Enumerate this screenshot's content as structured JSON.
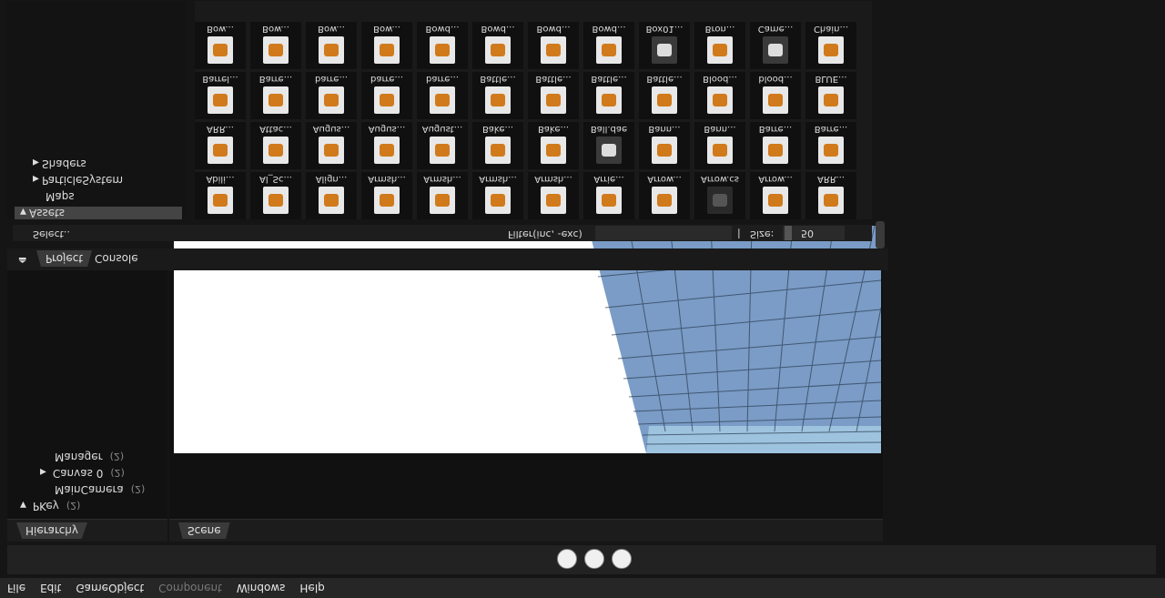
{
  "menubar": [
    "File",
    "Edit",
    "GameObject",
    "Component",
    "Windows",
    "Help"
  ],
  "hierarchy": {
    "tab": "Hierarchy",
    "items": [
      {
        "label": "PKey",
        "count": "(2)"
      },
      {
        "label": "MainCamera",
        "count": "(2)"
      },
      {
        "label": "Canvas 0",
        "count": "(2)"
      },
      {
        "label": "Manager",
        "count": "(2)"
      }
    ]
  },
  "scene": {
    "tab": "Scene"
  },
  "project": {
    "tabs": [
      "Project",
      "Console"
    ],
    "select_label": "Select..",
    "filter_label": "Filter(inc, -exc)",
    "size_label": "Size:",
    "size_value": "50"
  },
  "assets_tree": [
    "Assets",
    "Maps",
    "ParticleSystem",
    "Shaders"
  ],
  "asset_rows": [
    [
      "Abili...",
      "Al_Sc...",
      "Align...",
      "Armsh...",
      "Armsh...",
      "Armsh...",
      "Armsh...",
      "Arrie...",
      "Arrow...",
      "Arrow.cs",
      "Arrow...",
      "ARR..."
    ],
    [
      "ARR...",
      "Attac...",
      "Augus...",
      "Augus...",
      "August...",
      "Bake...",
      "Bake...",
      "Ball.dae",
      "Bann...",
      "Bann...",
      "Barre...",
      "Barre..."
    ],
    [
      "Barrel...",
      "Barre...",
      "barre...",
      "barre...",
      "barre...",
      "Battle...",
      "Battle...",
      "Battle...",
      "Battle...",
      "Blood...",
      "blood...",
      "BLUE..."
    ],
    [
      "Bow...",
      "Bow...",
      "Bow...",
      "Bow...",
      "Bowd...",
      "Bowd...",
      "Bowd...",
      "Bowd...",
      "Box01...",
      "Bron...",
      "Came...",
      "Chain..."
    ]
  ],
  "colors": {
    "accent": "#7a9cc6",
    "selected": "#444444"
  }
}
